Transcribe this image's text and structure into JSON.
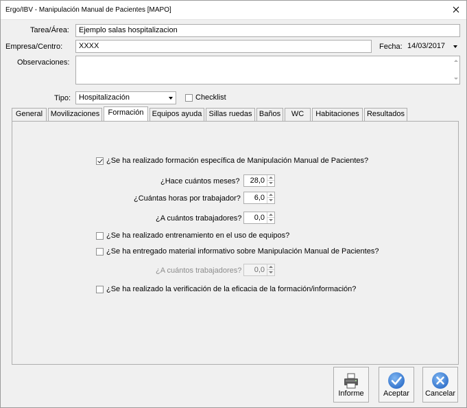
{
  "window": {
    "title": "Ergo/IBV - Manipulación Manual de Pacientes [MAPO]"
  },
  "form": {
    "tarea_label": "Tarea/Área:",
    "tarea_value": "Ejemplo salas hospitalizacion",
    "empresa_label": "Empresa/Centro:",
    "empresa_value": "XXXX",
    "fecha_label": "Fecha:",
    "fecha_value": "14/03/2017",
    "observaciones_label": "Observaciones:",
    "observaciones_value": "",
    "tipo_label": "Tipo:",
    "tipo_value": "Hospitalización",
    "checklist_label": "Checklist",
    "checklist_checked": false
  },
  "tabs": [
    {
      "label": "General",
      "active": false
    },
    {
      "label": "Movilizaciones",
      "active": false
    },
    {
      "label": "Formación",
      "active": true
    },
    {
      "label": "Equipos ayuda",
      "active": false
    },
    {
      "label": "Sillas ruedas",
      "active": false
    },
    {
      "label": "Baños",
      "active": false
    },
    {
      "label": "WC",
      "active": false
    },
    {
      "label": "Habitaciones",
      "active": false
    },
    {
      "label": "Resultados",
      "active": false
    }
  ],
  "formacion": {
    "q1_label": "¿Se ha realizado formación específica de Manipulación Manual de Pacientes?",
    "q1_checked": true,
    "meses_label": "¿Hace cuántos meses?",
    "meses_value": "28,0",
    "horas_label": "¿Cuántas horas por trabajador?",
    "horas_value": "6,0",
    "trabajadores_label": "¿A cuántos trabajadores?",
    "trabajadores_value": "0,0",
    "q2_label": "¿Se ha realizado entrenamiento en el uso de equipos?",
    "q2_checked": false,
    "q3_label": "¿Se ha entregado material informativo sobre Manipulación Manual de Pacientes?",
    "q3_checked": false,
    "trabajadores2_label": "¿A cuántos trabajadores?",
    "trabajadores2_value": "0,0",
    "q4_label": "¿Se ha realizado la verificación de la eficacia de la formación/información?",
    "q4_checked": false
  },
  "buttons": {
    "informe": "Informe",
    "aceptar": "Aceptar",
    "cancelar": "Cancelar"
  },
  "icons": {
    "close": "close-icon",
    "printer": "printer-icon",
    "accept": "check-circle-icon",
    "cancel": "x-circle-icon"
  },
  "colors": {
    "accent_blue": "#3b7dd8"
  }
}
